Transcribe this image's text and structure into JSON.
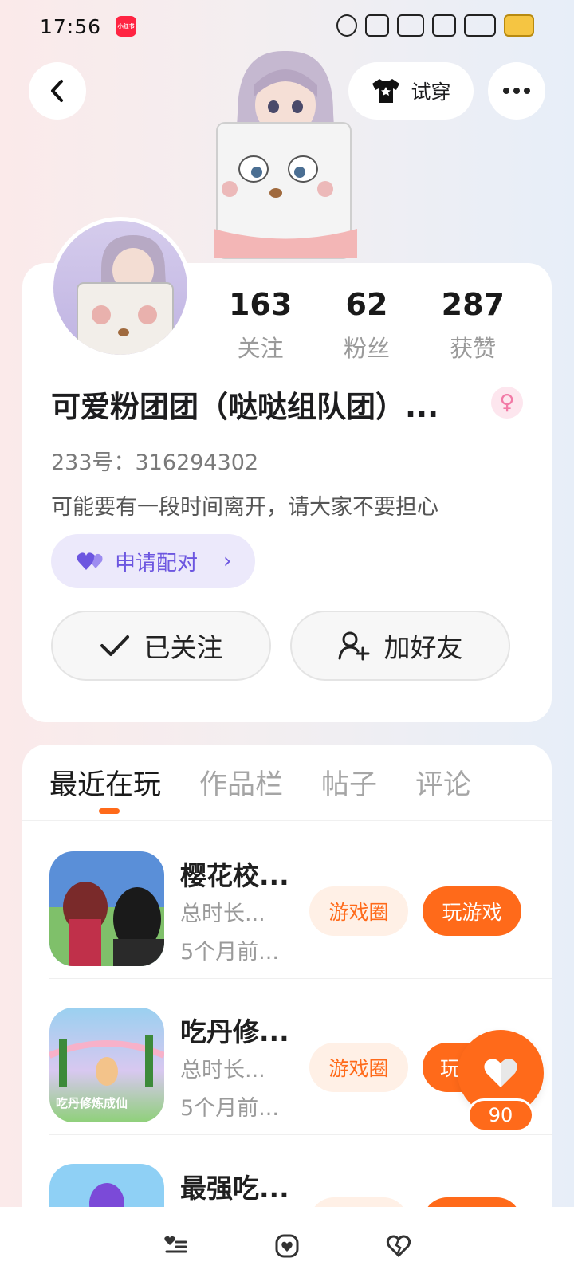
{
  "status_bar": {
    "time": "17:56",
    "app_badge": "小红书"
  },
  "header": {
    "try_on_label": "试穿"
  },
  "stats": [
    {
      "value": "163",
      "label": "关注"
    },
    {
      "value": "62",
      "label": "粉丝"
    },
    {
      "value": "287",
      "label": "获赞"
    }
  ],
  "profile": {
    "name": "可爱粉团团（哒哒组队团）...",
    "gender_icon": "female-icon",
    "id_line": "233号：316294302",
    "bio": "可能要有一段时间离开，请大家不要担心",
    "pair_label": "申请配对",
    "follow_label": "已关注",
    "add_friend_label": "加好友"
  },
  "tabs": [
    {
      "label": "最近在玩",
      "active": true
    },
    {
      "label": "作品栏",
      "active": false
    },
    {
      "label": "帖子",
      "active": false
    },
    {
      "label": "评论",
      "active": false
    }
  ],
  "games": [
    {
      "title": "樱花校...",
      "duration": "总时长...",
      "last_played": "5个月前...",
      "circle_label": "游戏圈",
      "play_label": "玩游戏"
    },
    {
      "title": "吃丹修...",
      "duration": "总时长...",
      "last_played": "5个月前...",
      "circle_label": "游戏圈",
      "play_label": "玩",
      "thumb_text": "吃丹修炼成仙"
    },
    {
      "title": "最强吃..."
    }
  ],
  "floating_like": {
    "count": "90"
  },
  "colors": {
    "accent": "#ff6a1a",
    "pair_purple": "#6c56e0",
    "card_bg": "#ffffff"
  }
}
